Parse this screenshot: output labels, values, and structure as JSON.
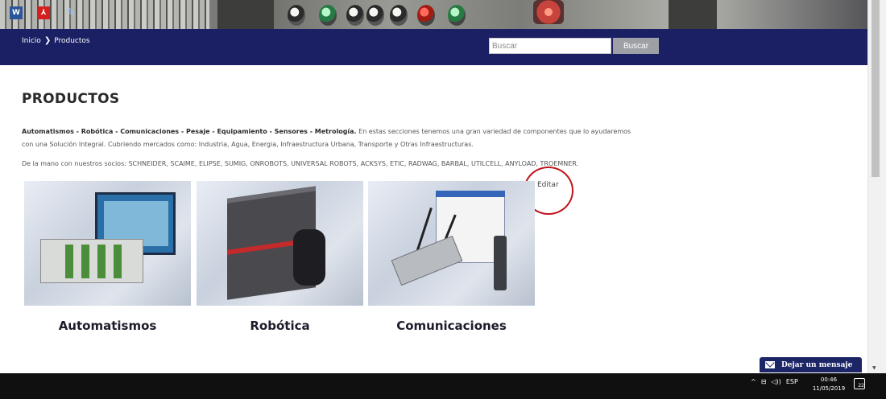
{
  "breadcrumb": {
    "home": "Inicio",
    "separator": "❯",
    "current": "Productos"
  },
  "search": {
    "placeholder": "Buscar",
    "button_label": "Buscar"
  },
  "page": {
    "title": "PRODUCTOS",
    "intro_bold": "Automatismos - Robótica - Comunicaciones - Pesaje - Equipamiento - Sensores - Metrología.",
    "intro_text": " En estas secciones tenemos una gran variedad de componentes que lo ayudaremos con una Solución Integral. Cubriendo mercados como: Industria, Agua, Energia, Infraestructura Urbana, Transporte y Otras Infraestructuras.",
    "partners": "De la mano con nuestros socios: SCHNEIDER, SCAIME, ELIPSE, SUMIG, ONROBOTS, UNIVERSAL ROBOTS, ACKSYS, ETIC, RADWAG, BARBAL, UTILCELL, ANYLOAD, TROEMNER.",
    "edit_label": "Editar"
  },
  "products": [
    {
      "label": "Automatismos"
    },
    {
      "label": "Robótica"
    },
    {
      "label": "Comunicaciones"
    }
  ],
  "chat": {
    "label": "Dejar un mensaje",
    "icon": "mail-icon"
  },
  "taskbar": {
    "apps": [
      {
        "icon": "word-icon",
        "glyph": "W"
      },
      {
        "icon": "pdf-icon",
        "glyph": "⅄"
      },
      {
        "icon": "app-icon",
        "glyph": "✎"
      }
    ],
    "tray": {
      "chevron": "^",
      "network": "⊟",
      "volume": "◁))",
      "language": "ESP"
    },
    "time": "00:46",
    "date": "11/05/2019",
    "notifications": "22"
  },
  "colors": {
    "navbar": "#1a2063",
    "chat": "#1c2566",
    "circle": "#c0141b"
  }
}
